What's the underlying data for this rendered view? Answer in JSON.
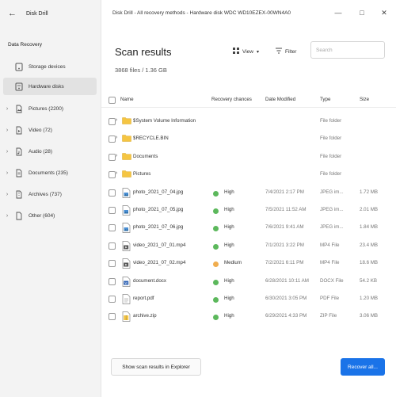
{
  "app": {
    "name": "Disk Drill",
    "window_title": "Disk Drill - All recovery methods - Hardware disk WDC WD10EZEX-00WN4A0"
  },
  "sidebar": {
    "section_label": "Data Recovery",
    "items": [
      {
        "label": "Storage devices",
        "icon": "storage-devices-icon",
        "expandable": false,
        "active": false
      },
      {
        "label": "Hardware disks",
        "icon": "hardware-disk-icon",
        "expandable": false,
        "active": true
      },
      {
        "label": "Pictures (2200)",
        "icon": "pictures-icon",
        "expandable": true,
        "active": false
      },
      {
        "label": "Video (72)",
        "icon": "video-icon",
        "expandable": true,
        "active": false
      },
      {
        "label": "Audio (28)",
        "icon": "audio-icon",
        "expandable": true,
        "active": false
      },
      {
        "label": "Documents (235)",
        "icon": "documents-icon",
        "expandable": true,
        "active": false
      },
      {
        "label": "Archives (737)",
        "icon": "archives-icon",
        "expandable": true,
        "active": false
      },
      {
        "label": "Other (604)",
        "icon": "other-icon",
        "expandable": true,
        "active": false
      }
    ]
  },
  "main": {
    "title": "Scan results",
    "subtitle": "3868 files / 1.36 GB",
    "view_label": "View",
    "filter_label": "Filter",
    "search_placeholder": "Search"
  },
  "table": {
    "columns": [
      "Name",
      "Recovery chances",
      "Date Modified",
      "Type",
      "Size"
    ],
    "rows": [
      {
        "kind": "folder",
        "name": "$System Volume Information",
        "chance": "",
        "date": "",
        "type": "File folder",
        "size": ""
      },
      {
        "kind": "folder",
        "name": "$RECYCLE.BIN",
        "chance": "",
        "date": "",
        "type": "File folder",
        "size": ""
      },
      {
        "kind": "folder",
        "name": "Documents",
        "chance": "",
        "date": "",
        "type": "File folder",
        "size": ""
      },
      {
        "kind": "folder",
        "name": "Pictures",
        "chance": "",
        "date": "",
        "type": "File folder",
        "size": ""
      },
      {
        "kind": "image",
        "name": "photo_2021_07_04.jpg",
        "chance": "High",
        "date": "7/4/2021 2:17 PM",
        "type": "JPEG im...",
        "size": "1.72 MB"
      },
      {
        "kind": "image",
        "name": "photo_2021_07_05.jpg",
        "chance": "High",
        "date": "7/5/2021 11:52 AM",
        "type": "JPEG im...",
        "size": "2.01 MB"
      },
      {
        "kind": "image",
        "name": "photo_2021_07_06.jpg",
        "chance": "High",
        "date": "7/6/2021 9:41 AM",
        "type": "JPEG im...",
        "size": "1.84 MB"
      },
      {
        "kind": "video",
        "name": "video_2021_07_01.mp4",
        "chance": "High",
        "date": "7/1/2021 3:22 PM",
        "type": "MP4 File",
        "size": "23.4 MB"
      },
      {
        "kind": "video",
        "name": "video_2021_07_02.mp4",
        "chance": "Medium",
        "date": "7/2/2021 6:11 PM",
        "type": "MP4 File",
        "size": "18.6 MB"
      },
      {
        "kind": "docx",
        "name": "document.docx",
        "chance": "High",
        "date": "6/28/2021 10:11 AM",
        "type": "DOCX File",
        "size": "54.2 KB"
      },
      {
        "kind": "pdf",
        "name": "report.pdf",
        "chance": "High",
        "date": "6/30/2021 3:05 PM",
        "type": "PDF File",
        "size": "1.20 MB"
      },
      {
        "kind": "zip",
        "name": "archive.zip",
        "chance": "High",
        "date": "6/29/2021 4:33 PM",
        "type": "ZIP File",
        "size": "3.06 MB"
      }
    ]
  },
  "footer": {
    "show_in_explorer": "Show scan results in Explorer",
    "recover_all": "Recover all..."
  },
  "colors": {
    "accent": "#1a73e8",
    "high": "#5cb85c",
    "medium": "#f0ad4e",
    "folder": "#f5c542"
  }
}
